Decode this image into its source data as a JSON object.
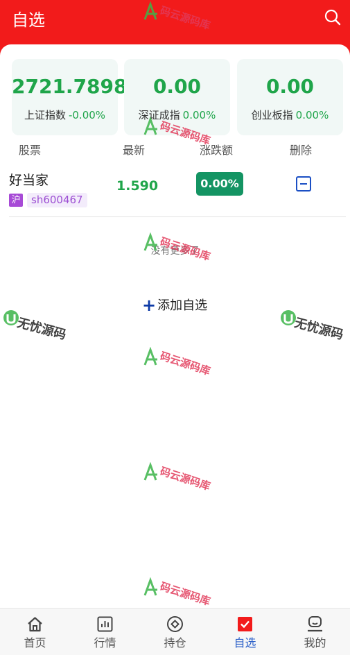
{
  "header": {
    "title": "自选"
  },
  "indices": [
    {
      "value": "2721.7898",
      "name": "上证指数",
      "change": "-0.00%"
    },
    {
      "value": "0.00",
      "name": "深证成指",
      "change": "0.00%"
    },
    {
      "value": "0.00",
      "name": "创业板指",
      "change": "0.00%"
    }
  ],
  "columns": {
    "stock": "股票",
    "latest": "最新",
    "change": "涨跌额",
    "delete": "删除"
  },
  "stocks": [
    {
      "name": "好当家",
      "market": "沪",
      "code": "sh600467",
      "price": "1.590",
      "change": "0.00%"
    }
  ],
  "list_end_text": "没有更多了",
  "add_button_label": "添加自选",
  "watermarks": {
    "a": "码云源码库",
    "b": "无忧源码"
  },
  "tabs": [
    {
      "label": "首页",
      "icon": "home-icon"
    },
    {
      "label": "行情",
      "icon": "chart-icon"
    },
    {
      "label": "持仓",
      "icon": "position-icon"
    },
    {
      "label": "自选",
      "icon": "checkbox-icon",
      "active": true
    },
    {
      "label": "我的",
      "icon": "user-icon"
    }
  ],
  "colors": {
    "brand_red": "#f21b1b",
    "rise_green": "#1fa54a",
    "badge_green": "#149463",
    "active_blue": "#2a5fc8",
    "card_bg": "#f1f8f6"
  }
}
